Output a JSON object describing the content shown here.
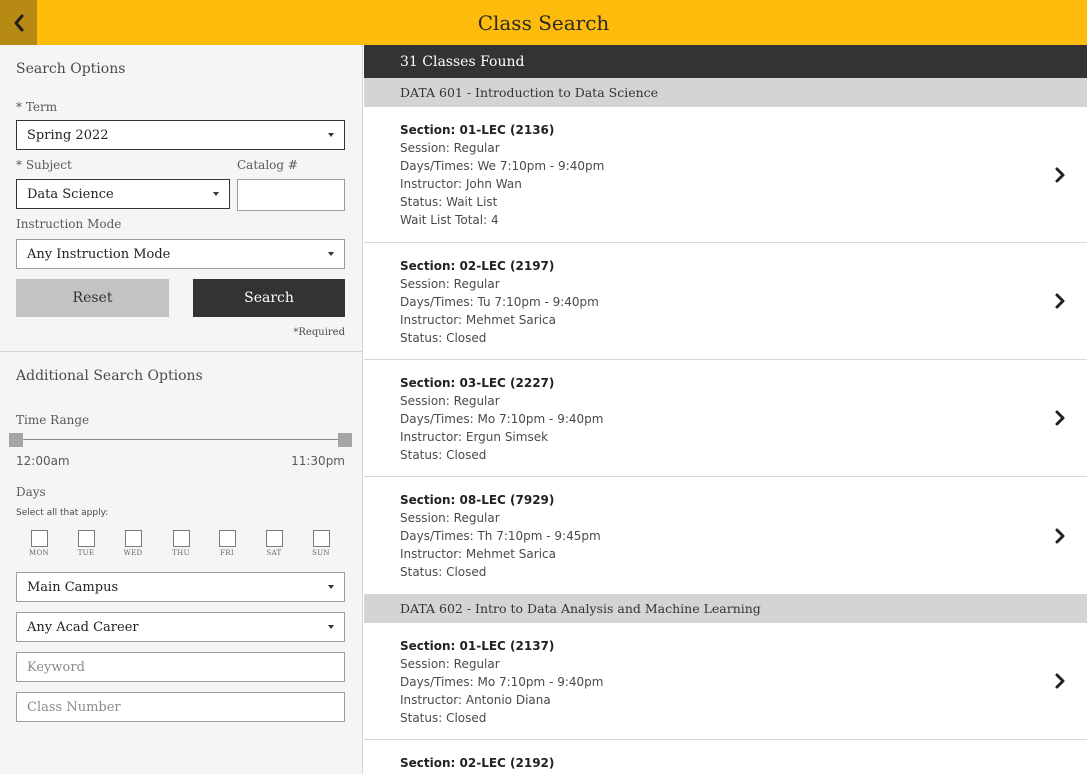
{
  "header": {
    "title": "Class Search",
    "back_icon": "chevron-left-icon"
  },
  "search_options": {
    "title": "Search Options",
    "term_label": "* Term",
    "term_value": "Spring 2022",
    "subject_label": "* Subject",
    "subject_value": "Data Science",
    "catalog_label": "Catalog #",
    "catalog_value": "",
    "mode_label": "Instruction Mode",
    "mode_value": "Any Instruction Mode",
    "reset_label": "Reset",
    "search_label": "Search",
    "required_note": "*Required"
  },
  "additional": {
    "title": "Additional Search Options",
    "time_range_label": "Time Range",
    "time_start": "12:00am",
    "time_end": "11:30pm",
    "days_label": "Days",
    "days_hint": "Select all that apply:",
    "days": [
      "MON",
      "TUE",
      "WED",
      "THU",
      "FRI",
      "SAT",
      "SUN"
    ],
    "campus_value": "Main Campus",
    "career_value": "Any Acad Career",
    "keyword_placeholder": "Keyword",
    "class_number_placeholder": "Class Number"
  },
  "results": {
    "count_label": "31 Classes Found",
    "courses": [
      {
        "title": "DATA 601 - Introduction to Data Science",
        "sections": [
          {
            "heading": "Section: 01-LEC (2136)",
            "lines": [
              "Session: Regular",
              "Days/Times: We 7:10pm - 9:40pm",
              "Instructor: John Wan",
              "Status: Wait List",
              "Wait List Total: 4"
            ]
          },
          {
            "heading": "Section: 02-LEC (2197)",
            "lines": [
              "Session: Regular",
              "Days/Times: Tu 7:10pm - 9:40pm",
              "Instructor: Mehmet Sarica",
              "Status: Closed"
            ]
          },
          {
            "heading": "Section: 03-LEC (2227)",
            "lines": [
              "Session: Regular",
              "Days/Times: Mo 7:10pm - 9:40pm",
              "Instructor: Ergun Simsek",
              "Status: Closed"
            ]
          },
          {
            "heading": "Section: 08-LEC (7929)",
            "lines": [
              "Session: Regular",
              "Days/Times: Th 7:10pm - 9:45pm",
              "Instructor: Mehmet Sarica",
              "Status: Closed"
            ]
          }
        ]
      },
      {
        "title": "DATA 602 - Intro to Data Analysis and Machine Learning",
        "sections": [
          {
            "heading": "Section: 01-LEC (2137)",
            "lines": [
              "Session: Regular",
              "Days/Times: Mo 7:10pm - 9:40pm",
              "Instructor: Antonio Diana",
              "Status: Closed"
            ]
          },
          {
            "heading": "Section: 02-LEC (2192)",
            "lines": []
          }
        ]
      }
    ]
  }
}
